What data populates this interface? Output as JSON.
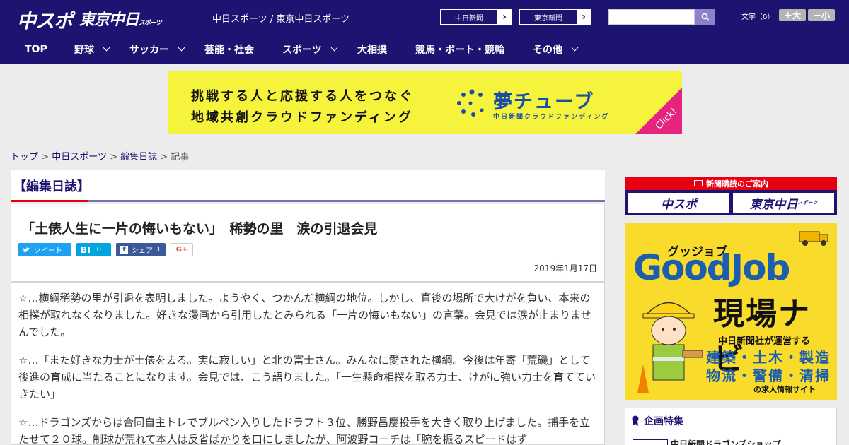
{
  "header": {
    "logo_chuspo": "中スポ",
    "logo_tokyo": "東京中日",
    "logo_tokyo_small": "スポーツ",
    "site_links": "中日スポーツ / 東京中日スポーツ",
    "ext_links": [
      "中日新聞",
      "東京新聞"
    ],
    "search_placeholder": "",
    "font_size_label": "文字（0）",
    "font_plus": "＋大",
    "font_minus": "－小"
  },
  "nav": [
    {
      "label": "TOP",
      "dropdown": false
    },
    {
      "label": "野球",
      "dropdown": true
    },
    {
      "label": "サッカー",
      "dropdown": true
    },
    {
      "label": "芸能・社会",
      "dropdown": false
    },
    {
      "label": "スポーツ",
      "dropdown": true
    },
    {
      "label": "大相撲",
      "dropdown": false
    },
    {
      "label": "競馬・ボート・競輪",
      "dropdown": false
    },
    {
      "label": "その他",
      "dropdown": true
    }
  ],
  "banner": {
    "line1": "挑戦する人と応援する人をつなぐ",
    "line2": "地域共創クラウドファンディング",
    "brand": "夢チューブ",
    "brand_sub": "中日新聞クラウドファンディング",
    "click": "Click!"
  },
  "breadcrumb": {
    "items": [
      "トップ",
      "中日スポーツ",
      "編集日誌"
    ],
    "current": "記事",
    "separator": ">"
  },
  "category": "【編集日誌】",
  "article": {
    "title": "「土俵人生に一片の悔いもない」　稀勢の里　涙の引退会見",
    "sns": {
      "tweet": "ツイート",
      "hatena_count": "0",
      "share": "シェア",
      "share_count": "1",
      "gplus": "G+"
    },
    "date": "2019年1月17日",
    "paragraphs": [
      "☆…横綱稀勢の里が引退を表明しました。ようやく、つかんだ横綱の地位。しかし、直後の場所で大けがを負い、本来の相撲が取れなくなりました。好きな漫画から引用したとみられる「一片の悔いもない」の言葉。会見では涙が止まりませんでした。",
      "☆…「また好きな力士が土俵を去る。実に寂しい」と北の富士さん。みんなに愛された横綱。今後は年寄「荒磯」として後進の育成に当たることになります。会見では、こう語りました。「一生懸命相撲を取る力士、けがに強い力士を育てていきたい」",
      "☆…ドラゴンズからは合同自主トレでブルペン入りしたドラフト３位、勝野昌慶投手を大きく取り上げました。捕手を立たせて２０球。制球が荒れて本人は反省ばかりを口にしましたが、阿波野コーチは「腕を振るスピードはず"
    ]
  },
  "sidebar": {
    "subscribe_title": "新聞購読のご案内",
    "subscribe_boxes": [
      "中スポ",
      "東京中日"
    ],
    "subscribe_small": "スポーツ",
    "goodjob": {
      "kana": "グッジョブ",
      "title": "GoodJob",
      "navi": "現場ナビ",
      "line1": "中日新聞社が運営する",
      "line2": "建築・土木・製造",
      "line3": "物流・警備・清掃",
      "line4": "の求人情報サイト"
    },
    "feature_title": "企画特集",
    "feature_item": "中日新聞ドラゴンズショップ"
  },
  "colors": {
    "brand": "#1d1370",
    "accent": "#e60012",
    "banner_bg": "#f6f33c",
    "goodjob_bg": "#f9dc2b"
  }
}
